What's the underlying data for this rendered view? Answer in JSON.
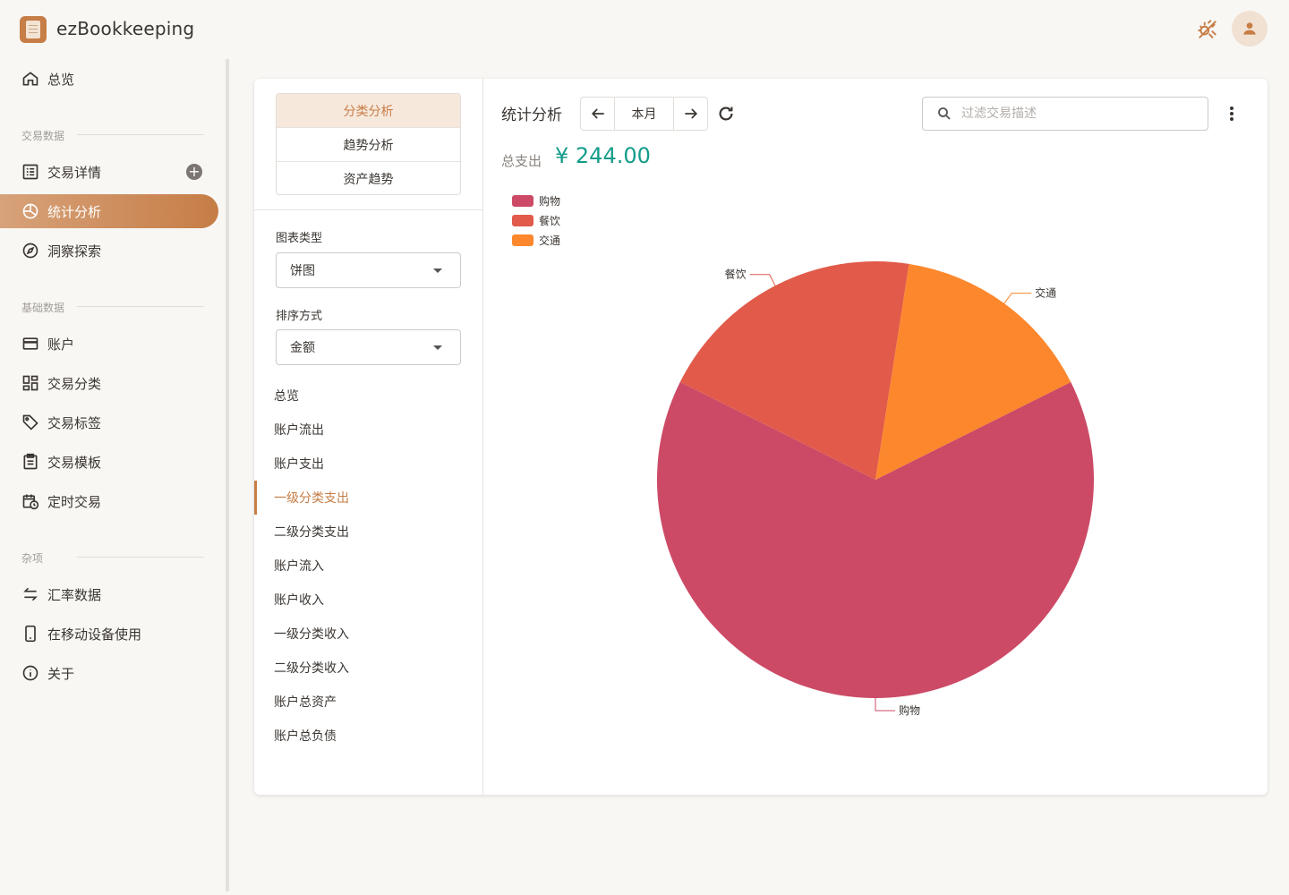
{
  "app": {
    "title": "ezBookkeeping"
  },
  "sidebar": {
    "overview": "总览",
    "sections": {
      "transactions": "交易数据",
      "basic": "基础数据",
      "misc": "杂项"
    },
    "items": [
      {
        "label": "交易详情",
        "icon": "list-icon"
      },
      {
        "label": "统计分析",
        "icon": "pie-chart-icon",
        "active": true
      },
      {
        "label": "洞察探索",
        "icon": "compass-icon"
      },
      {
        "label": "账户",
        "icon": "credit-card-icon"
      },
      {
        "label": "交易分类",
        "icon": "grid-icon"
      },
      {
        "label": "交易标签",
        "icon": "tag-icon"
      },
      {
        "label": "交易模板",
        "icon": "clipboard-icon"
      },
      {
        "label": "定时交易",
        "icon": "calendar-clock-icon"
      },
      {
        "label": "汇率数据",
        "icon": "swap-icon"
      },
      {
        "label": "在移动设备使用",
        "icon": "phone-icon"
      },
      {
        "label": "关于",
        "icon": "info-icon"
      }
    ]
  },
  "analysis_tabs": [
    "分类分析",
    "趋势分析",
    "资产趋势"
  ],
  "filters": {
    "chart_type_label": "图表类型",
    "chart_type_value": "饼图",
    "sort_label": "排序方式",
    "sort_value": "金额"
  },
  "stat_items": [
    "总览",
    "账户流出",
    "账户支出",
    "一级分类支出",
    "二级分类支出",
    "账户流入",
    "账户收入",
    "一级分类收入",
    "二级分类收入",
    "账户总资产",
    "账户总负债"
  ],
  "main": {
    "title": "统计分析",
    "period": "本月",
    "search_placeholder": "过滤交易描述",
    "total_label": "总支出",
    "total_value": "¥ 244.00"
  },
  "colors": {
    "accent": "#c67d46",
    "total": "#159c8b"
  },
  "chart_data": {
    "type": "pie",
    "categories": [
      "购物",
      "餐饮",
      "交通"
    ],
    "values": [
      158,
      49,
      37
    ],
    "colors": [
      "#cc4a66",
      "#e15a4a",
      "#fc872d"
    ],
    "legend": "top-left"
  }
}
